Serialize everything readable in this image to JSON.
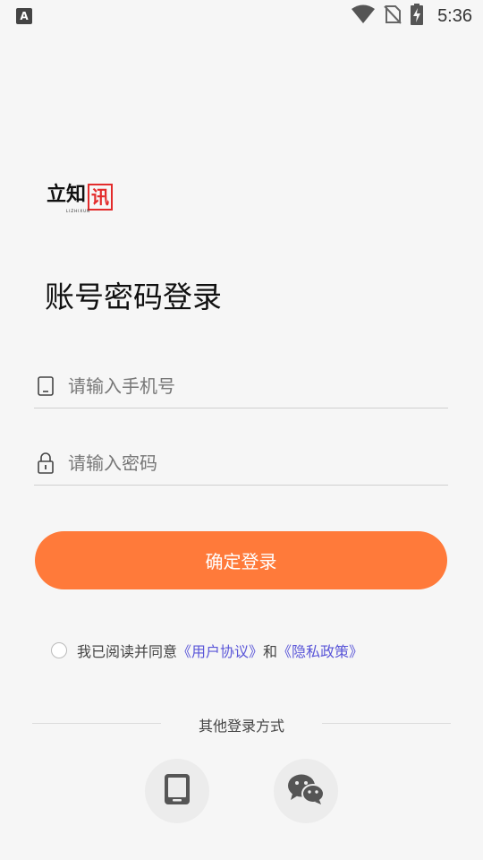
{
  "status_bar": {
    "app_indicator": "A",
    "time": "5:36",
    "icons": [
      "wifi-icon",
      "no-sim-icon",
      "battery-charging-icon"
    ]
  },
  "logo": {
    "text": "立知",
    "box_char": "讯",
    "subtitle": "LIZHIXUN"
  },
  "page_title": "账号密码登录",
  "phone_field": {
    "placeholder": "请输入手机号",
    "value": "",
    "icon": "phone-icon"
  },
  "password_field": {
    "placeholder": "请输入密码",
    "value": "",
    "icon": "lock-icon"
  },
  "submit_label": "确定登录",
  "agreement": {
    "prefix": "我已阅读并同意",
    "user_agreement": "《用户协议》",
    "conjunction": "和",
    "privacy_policy": "《隐私政策》",
    "checked": false
  },
  "other_login": {
    "label": "其他登录方式",
    "options": [
      "phone-login-icon",
      "wechat-icon"
    ]
  },
  "colors": {
    "accent": "#ff7a3a",
    "link": "#5a56d8",
    "logo_red": "#e32b2b",
    "background": "#f6f6f6"
  }
}
